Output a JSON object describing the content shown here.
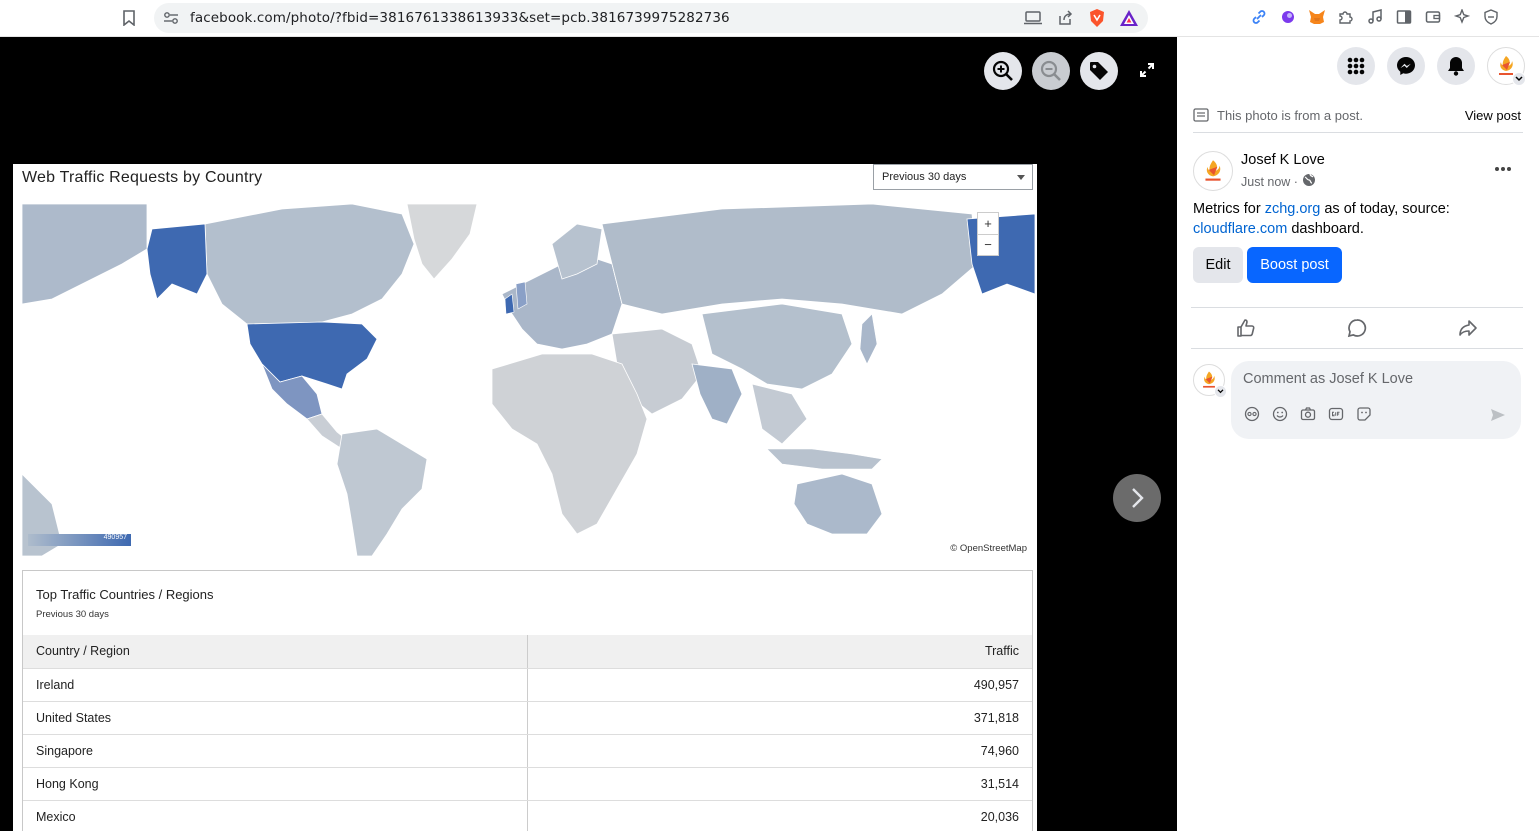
{
  "browser": {
    "url": "facebook.com/photo/?fbid=3816761338613933&set=pcb.3816739975282736"
  },
  "dashboard": {
    "title": "Web Traffic Requests by Country",
    "period_select": "Previous 30 days",
    "map_zoom_in": "+",
    "map_zoom_out": "−",
    "map_attribution": "© OpenStreetMap",
    "legend_max": "490957",
    "table_panel": {
      "title": "Top Traffic Countries / Regions",
      "subtitle": "Previous 30 days",
      "columns": [
        "Country / Region",
        "Traffic"
      ],
      "rows": [
        {
          "country": "Ireland",
          "traffic": "490,957"
        },
        {
          "country": "United States",
          "traffic": "371,818"
        },
        {
          "country": "Singapore",
          "traffic": "74,960"
        },
        {
          "country": "Hong Kong",
          "traffic": "31,514"
        },
        {
          "country": "Mexico",
          "traffic": "20,036"
        }
      ]
    }
  },
  "side_panel": {
    "post_note": "This photo is from a post.",
    "view_post": "View post",
    "author": "Josef K Love",
    "time": "Just now ·",
    "post_text_1": "Metrics for ",
    "post_link_1": "zchg.org",
    "post_text_2": " as of today, source: ",
    "post_link_2": "cloudflare.com",
    "post_text_3": " dashboard.",
    "edit_label": "Edit",
    "boost_label": "Boost post",
    "comment_placeholder": "Comment as Josef K Love"
  },
  "colors": {
    "fb_blue": "#0866ff",
    "link_blue": "#0064d1",
    "map_high": "#3e69b1",
    "map_mid": "#a9b8cb",
    "map_low": "#d0d3d6"
  }
}
